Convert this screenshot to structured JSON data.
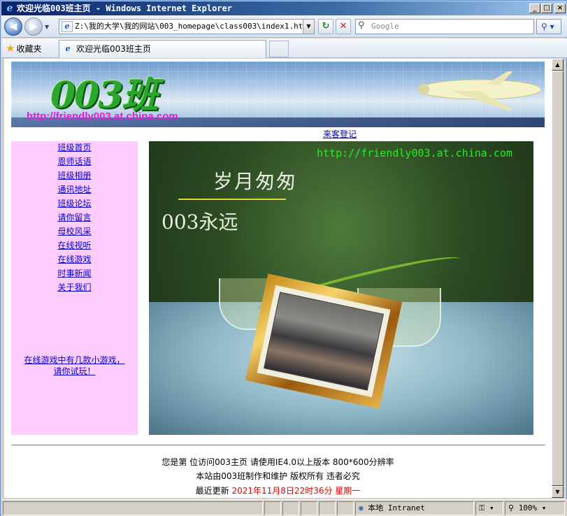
{
  "window": {
    "title": "欢迎光临003班主页 - Windows Internet Explorer",
    "buttons": {
      "minimize": "_",
      "maximize": "□",
      "close": "×"
    }
  },
  "toolbar": {
    "back_icon": "back-arrow-icon",
    "address": "Z:\\我的大学\\我的网站\\003_homepage\\class003\\index1.html",
    "search_placeholder": "Google",
    "refresh_glyph": "↻",
    "stop_glyph": "✕",
    "search_btn": "⚲"
  },
  "tabs": {
    "favorites_label": "收藏夹",
    "active_tab": "欢迎光临003班主页"
  },
  "page": {
    "banner": {
      "logo_text": "003班",
      "url_text": "http://friendly003.at.china.com"
    },
    "guestbook_link": "来客登记",
    "nav": [
      "班级首页",
      "恩师话语",
      "班级相册",
      "通讯地址",
      "班级论坛",
      "请你留言",
      "母校风采",
      "在线视听",
      "在线游戏",
      "时事新闻",
      "关于我们"
    ],
    "nav_note": "在线游戏中有几款小游戏，请你试玩！",
    "hero": {
      "url_text": "http://friendly003.at.china.com",
      "slogan1": "岁月匆匆",
      "slogan2": "003永远"
    },
    "footer": {
      "line1": "您是第  位访问003主页  请使用IE4.0以上版本  800*600分辨率",
      "line2": "本站由003班制作和维护  版权所有  违者必究",
      "line3_label": "最近更新 ",
      "line3_date": "2021年11月8日22时36分  星期一"
    }
  },
  "statusbar": {
    "zone": "本地 Intranet",
    "zoom": "100%"
  },
  "colors": {
    "nav_bg": "#ffccff",
    "link": "#0000cc",
    "date_red": "#e00000",
    "hero_url": "#22ee22"
  }
}
